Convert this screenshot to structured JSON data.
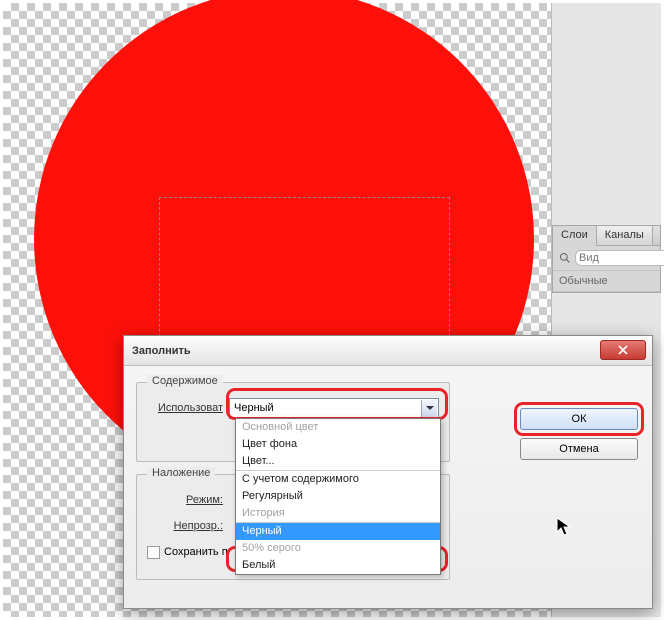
{
  "panel": {
    "tabs": [
      "Слои",
      "Каналы"
    ],
    "search_placeholder": "Вид",
    "blend_mode": "Обычные"
  },
  "dialog": {
    "title": "Заполнить",
    "ok": "ОК",
    "cancel": "Отмена",
    "contents": {
      "legend": "Содержимое",
      "use_label": "Использоват",
      "use_value": "Черный"
    },
    "overlay": {
      "legend": "Наложение",
      "mode_label": "Режим:",
      "opacity_label": "Непрозр.:",
      "preserve_label": "Сохранить п"
    }
  },
  "dropdown": {
    "items": [
      {
        "label": "Основной цвет",
        "state": "disabled"
      },
      {
        "label": "Цвет фона",
        "state": "normal"
      },
      {
        "label": "Цвет...",
        "state": "normal"
      },
      {
        "label": "С учетом содержимого",
        "state": "normal"
      },
      {
        "label": "Регулярный",
        "state": "normal"
      },
      {
        "label": "История",
        "state": "disabled"
      },
      {
        "label": "Черный",
        "state": "selected"
      },
      {
        "label": "50% серого",
        "state": "disabled"
      },
      {
        "label": "Белый",
        "state": "normal"
      }
    ]
  }
}
